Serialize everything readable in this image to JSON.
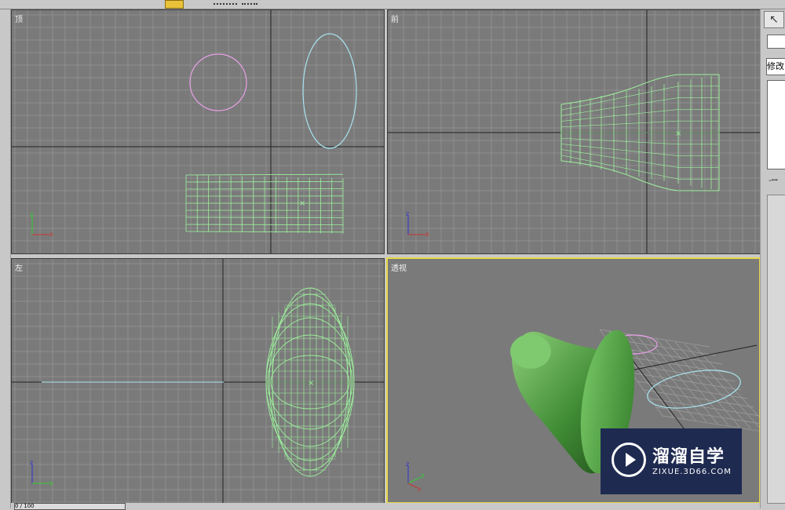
{
  "viewports": {
    "top": {
      "label": "顶"
    },
    "front": {
      "label": "前"
    },
    "left": {
      "label": "左"
    },
    "perspective": {
      "label": "透视"
    }
  },
  "axis_labels": {
    "x": "x",
    "y": "y",
    "z": "z"
  },
  "command_panel": {
    "modify_label": "修改",
    "pin_label": "-ꟷ"
  },
  "timeline": {
    "frame_label": "0 / 100"
  },
  "watermark": {
    "title": "溜溜自学",
    "url": "ZIXUE.3D66.COM"
  },
  "colors": {
    "viewport_bg": "#7a7a7a",
    "grid": "#8f8f8f",
    "mesh": "#9cf09c",
    "circle": "#e8a0e8",
    "ellipse": "#a8e4f0",
    "active_border": "#e8d84a"
  }
}
